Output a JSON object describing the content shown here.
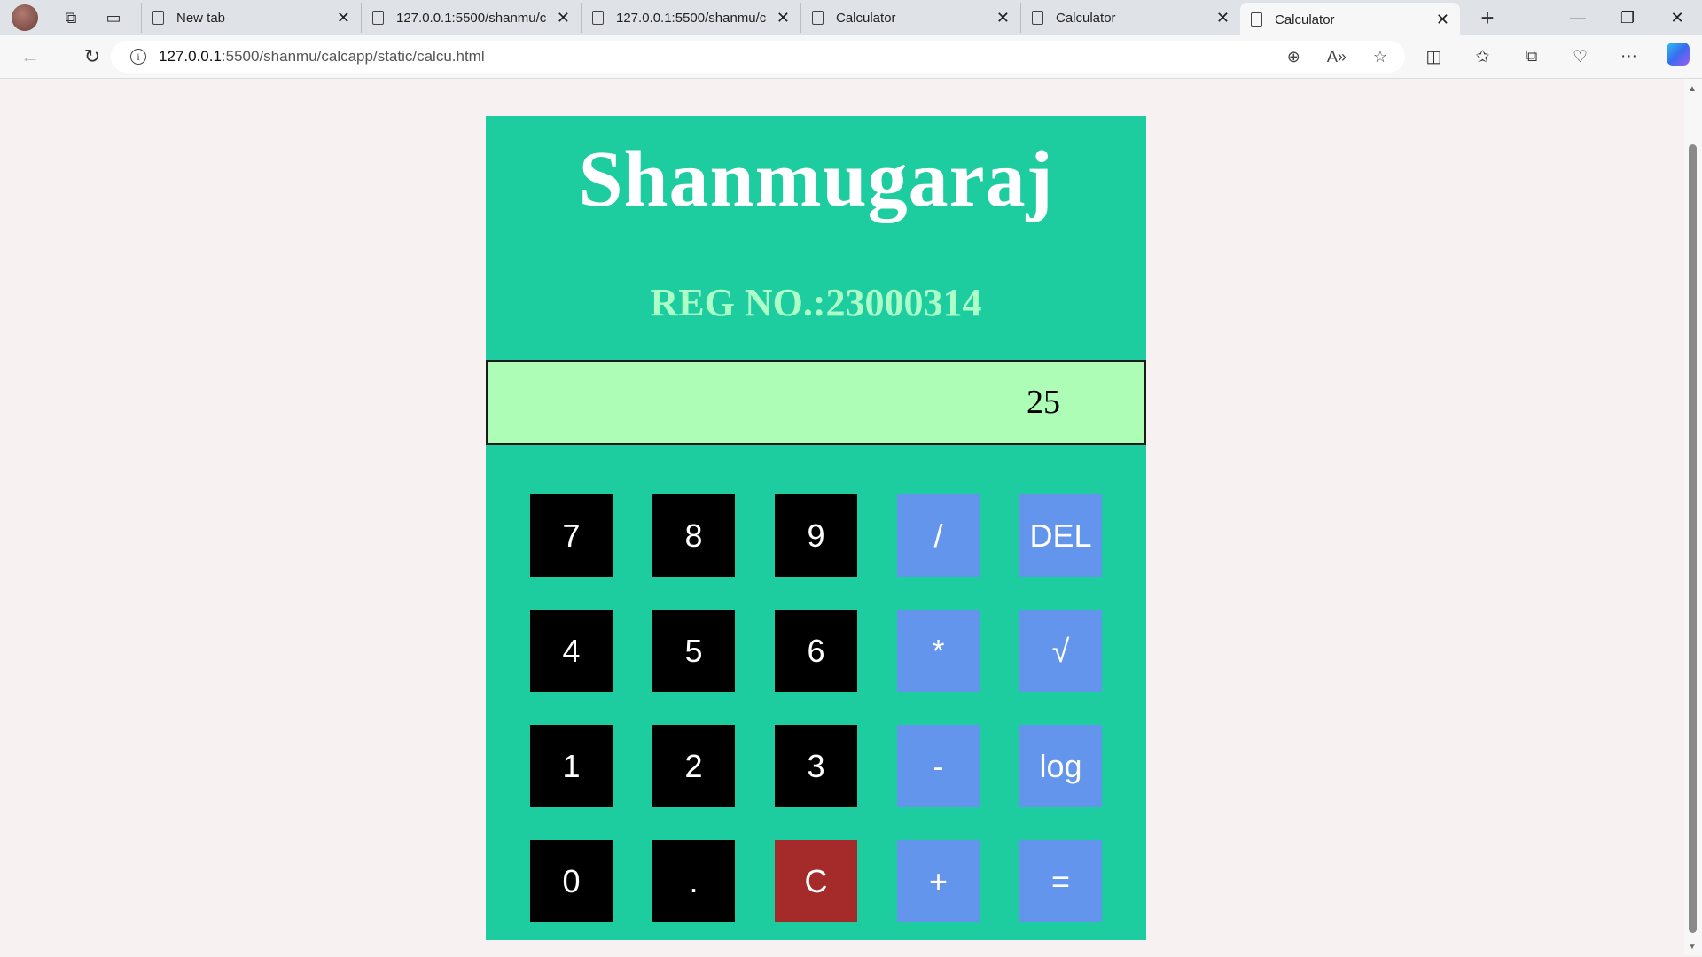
{
  "browser": {
    "tabs": [
      {
        "label": "New tab",
        "active": false
      },
      {
        "label": "127.0.0.1:5500/shanmu/c",
        "active": false
      },
      {
        "label": "127.0.0.1:5500/shanmu/c",
        "active": false
      },
      {
        "label": "Calculator",
        "active": false
      },
      {
        "label": "Calculator",
        "active": false
      },
      {
        "label": "Calculator",
        "active": true
      }
    ],
    "url_host": "127.0.0.1",
    "url_path": ":5500/shanmu/calcapp/static/calcu.html"
  },
  "calculator": {
    "title": "Shanmugaraj",
    "reg": "REG NO.:23000314",
    "display_value": "25",
    "keys": [
      {
        "label": "7",
        "kind": "num"
      },
      {
        "label": "8",
        "kind": "num"
      },
      {
        "label": "9",
        "kind": "num"
      },
      {
        "label": "/",
        "kind": "op"
      },
      {
        "label": "DEL",
        "kind": "op"
      },
      {
        "label": "4",
        "kind": "num"
      },
      {
        "label": "5",
        "kind": "num"
      },
      {
        "label": "6",
        "kind": "num"
      },
      {
        "label": "*",
        "kind": "op"
      },
      {
        "label": "√",
        "kind": "op"
      },
      {
        "label": "1",
        "kind": "num"
      },
      {
        "label": "2",
        "kind": "num"
      },
      {
        "label": "3",
        "kind": "num"
      },
      {
        "label": "-",
        "kind": "op"
      },
      {
        "label": "log",
        "kind": "op"
      },
      {
        "label": "0",
        "kind": "num"
      },
      {
        "label": ".",
        "kind": "num"
      },
      {
        "label": "C",
        "kind": "clear"
      },
      {
        "label": "+",
        "kind": "op"
      },
      {
        "label": "=",
        "kind": "op"
      }
    ],
    "colors": {
      "background": "#1dcc9f",
      "display": "#adfdb7",
      "number_key": "#000000",
      "operator_key": "#6495ed",
      "clear_key": "#a52a2a"
    }
  }
}
